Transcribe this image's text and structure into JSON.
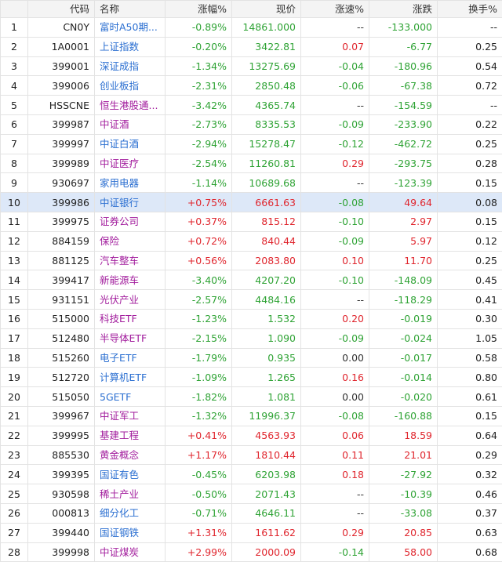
{
  "colors": {
    "up": "#e0262e",
    "down": "#2fa335",
    "name_blue": "#2b6fd1",
    "name_purple": "#a21d9d",
    "selected_row_bg": "#dde8f8"
  },
  "header": {
    "index": "",
    "code": "代码",
    "name": "名称",
    "change_pct": "涨幅%",
    "price": "现价",
    "speed": "涨速%",
    "change": "涨跌",
    "turnover": "换手%"
  },
  "rows": [
    {
      "idx": "1",
      "code": "CN0Y",
      "name": "富时A50期...",
      "name_color": "blue",
      "pct": "-0.89%",
      "price": "14861.000",
      "speed": "--",
      "chg": "-133.000",
      "turn": "--",
      "pct_dir": "down",
      "price_dir": "down",
      "speed_dir": "flat",
      "chg_dir": "down"
    },
    {
      "idx": "2",
      "code": "1A0001",
      "name": "上证指数",
      "name_color": "blue",
      "pct": "-0.20%",
      "price": "3422.81",
      "speed": "0.07",
      "chg": "-6.77",
      "turn": "0.25",
      "pct_dir": "down",
      "price_dir": "down",
      "speed_dir": "up",
      "chg_dir": "down"
    },
    {
      "idx": "3",
      "code": "399001",
      "name": "深证成指",
      "name_color": "blue",
      "pct": "-1.34%",
      "price": "13275.69",
      "speed": "-0.04",
      "chg": "-180.96",
      "turn": "0.54",
      "pct_dir": "down",
      "price_dir": "down",
      "speed_dir": "down",
      "chg_dir": "down"
    },
    {
      "idx": "4",
      "code": "399006",
      "name": "创业板指",
      "name_color": "blue",
      "pct": "-2.31%",
      "price": "2850.48",
      "speed": "-0.06",
      "chg": "-67.38",
      "turn": "0.72",
      "pct_dir": "down",
      "price_dir": "down",
      "speed_dir": "down",
      "chg_dir": "down"
    },
    {
      "idx": "5",
      "code": "HSSCNE",
      "name": "恒生港股通...",
      "name_color": "purple",
      "pct": "-3.42%",
      "price": "4365.74",
      "speed": "--",
      "chg": "-154.59",
      "turn": "--",
      "pct_dir": "down",
      "price_dir": "down",
      "speed_dir": "flat",
      "chg_dir": "down"
    },
    {
      "idx": "6",
      "code": "399987",
      "name": "中证酒",
      "name_color": "purple",
      "pct": "-2.73%",
      "price": "8335.53",
      "speed": "-0.09",
      "chg": "-233.90",
      "turn": "0.22",
      "pct_dir": "down",
      "price_dir": "down",
      "speed_dir": "down",
      "chg_dir": "down"
    },
    {
      "idx": "7",
      "code": "399997",
      "name": "中证白酒",
      "name_color": "blue",
      "pct": "-2.94%",
      "price": "15278.47",
      "speed": "-0.12",
      "chg": "-462.72",
      "turn": "0.25",
      "pct_dir": "down",
      "price_dir": "down",
      "speed_dir": "down",
      "chg_dir": "down"
    },
    {
      "idx": "8",
      "code": "399989",
      "name": "中证医疗",
      "name_color": "purple",
      "pct": "-2.54%",
      "price": "11260.81",
      "speed": "0.29",
      "chg": "-293.75",
      "turn": "0.28",
      "pct_dir": "down",
      "price_dir": "down",
      "speed_dir": "up",
      "chg_dir": "down"
    },
    {
      "idx": "9",
      "code": "930697",
      "name": "家用电器",
      "name_color": "blue",
      "pct": "-1.14%",
      "price": "10689.68",
      "speed": "--",
      "chg": "-123.39",
      "turn": "0.15",
      "pct_dir": "down",
      "price_dir": "down",
      "speed_dir": "flat",
      "chg_dir": "down"
    },
    {
      "idx": "10",
      "code": "399986",
      "name": "中证银行",
      "name_color": "blue",
      "pct": "+0.75%",
      "price": "6661.63",
      "speed": "-0.08",
      "chg": "49.64",
      "turn": "0.08",
      "pct_dir": "up",
      "price_dir": "up",
      "speed_dir": "down",
      "chg_dir": "up",
      "selected": true
    },
    {
      "idx": "11",
      "code": "399975",
      "name": "证券公司",
      "name_color": "purple",
      "pct": "+0.37%",
      "price": "815.12",
      "speed": "-0.10",
      "chg": "2.97",
      "turn": "0.15",
      "pct_dir": "up",
      "price_dir": "up",
      "speed_dir": "down",
      "chg_dir": "up"
    },
    {
      "idx": "12",
      "code": "884159",
      "name": "保险",
      "name_color": "purple",
      "pct": "+0.72%",
      "price": "840.44",
      "speed": "-0.09",
      "chg": "5.97",
      "turn": "0.12",
      "pct_dir": "up",
      "price_dir": "up",
      "speed_dir": "down",
      "chg_dir": "up"
    },
    {
      "idx": "13",
      "code": "881125",
      "name": "汽车整车",
      "name_color": "purple",
      "pct": "+0.56%",
      "price": "2083.80",
      "speed": "0.10",
      "chg": "11.70",
      "turn": "0.25",
      "pct_dir": "up",
      "price_dir": "up",
      "speed_dir": "up",
      "chg_dir": "up"
    },
    {
      "idx": "14",
      "code": "399417",
      "name": "新能源车",
      "name_color": "purple",
      "pct": "-3.40%",
      "price": "4207.20",
      "speed": "-0.10",
      "chg": "-148.09",
      "turn": "0.45",
      "pct_dir": "down",
      "price_dir": "down",
      "speed_dir": "down",
      "chg_dir": "down"
    },
    {
      "idx": "15",
      "code": "931151",
      "name": "光伏产业",
      "name_color": "purple",
      "pct": "-2.57%",
      "price": "4484.16",
      "speed": "--",
      "chg": "-118.29",
      "turn": "0.41",
      "pct_dir": "down",
      "price_dir": "down",
      "speed_dir": "flat",
      "chg_dir": "down"
    },
    {
      "idx": "16",
      "code": "515000",
      "name": "科技ETF",
      "name_color": "purple",
      "pct": "-1.23%",
      "price": "1.532",
      "speed": "0.20",
      "chg": "-0.019",
      "turn": "0.30",
      "pct_dir": "down",
      "price_dir": "down",
      "speed_dir": "up",
      "chg_dir": "down"
    },
    {
      "idx": "17",
      "code": "512480",
      "name": "半导体ETF",
      "name_color": "purple",
      "pct": "-2.15%",
      "price": "1.090",
      "speed": "-0.09",
      "chg": "-0.024",
      "turn": "1.05",
      "pct_dir": "down",
      "price_dir": "down",
      "speed_dir": "down",
      "chg_dir": "down"
    },
    {
      "idx": "18",
      "code": "515260",
      "name": "电子ETF",
      "name_color": "blue",
      "pct": "-1.79%",
      "price": "0.935",
      "speed": "0.00",
      "chg": "-0.017",
      "turn": "0.58",
      "pct_dir": "down",
      "price_dir": "down",
      "speed_dir": "flat",
      "chg_dir": "down"
    },
    {
      "idx": "19",
      "code": "512720",
      "name": "计算机ETF",
      "name_color": "blue",
      "pct": "-1.09%",
      "price": "1.265",
      "speed": "0.16",
      "chg": "-0.014",
      "turn": "0.80",
      "pct_dir": "down",
      "price_dir": "down",
      "speed_dir": "up",
      "chg_dir": "down"
    },
    {
      "idx": "20",
      "code": "515050",
      "name": "5GETF",
      "name_color": "blue",
      "pct": "-1.82%",
      "price": "1.081",
      "speed": "0.00",
      "chg": "-0.020",
      "turn": "0.61",
      "pct_dir": "down",
      "price_dir": "down",
      "speed_dir": "flat",
      "chg_dir": "down"
    },
    {
      "idx": "21",
      "code": "399967",
      "name": "中证军工",
      "name_color": "purple",
      "pct": "-1.32%",
      "price": "11996.37",
      "speed": "-0.08",
      "chg": "-160.88",
      "turn": "0.15",
      "pct_dir": "down",
      "price_dir": "down",
      "speed_dir": "down",
      "chg_dir": "down"
    },
    {
      "idx": "22",
      "code": "399995",
      "name": "基建工程",
      "name_color": "purple",
      "pct": "+0.41%",
      "price": "4563.93",
      "speed": "0.06",
      "chg": "18.59",
      "turn": "0.64",
      "pct_dir": "up",
      "price_dir": "up",
      "speed_dir": "up",
      "chg_dir": "up"
    },
    {
      "idx": "23",
      "code": "885530",
      "name": "黄金概念",
      "name_color": "purple",
      "pct": "+1.17%",
      "price": "1810.44",
      "speed": "0.11",
      "chg": "21.01",
      "turn": "0.29",
      "pct_dir": "up",
      "price_dir": "up",
      "speed_dir": "up",
      "chg_dir": "up"
    },
    {
      "idx": "24",
      "code": "399395",
      "name": "国证有色",
      "name_color": "blue",
      "pct": "-0.45%",
      "price": "6203.98",
      "speed": "0.18",
      "chg": "-27.92",
      "turn": "0.32",
      "pct_dir": "down",
      "price_dir": "down",
      "speed_dir": "up",
      "chg_dir": "down"
    },
    {
      "idx": "25",
      "code": "930598",
      "name": "稀土产业",
      "name_color": "purple",
      "pct": "-0.50%",
      "price": "2071.43",
      "speed": "--",
      "chg": "-10.39",
      "turn": "0.46",
      "pct_dir": "down",
      "price_dir": "down",
      "speed_dir": "flat",
      "chg_dir": "down"
    },
    {
      "idx": "26",
      "code": "000813",
      "name": "细分化工",
      "name_color": "blue",
      "pct": "-0.71%",
      "price": "4646.11",
      "speed": "--",
      "chg": "-33.08",
      "turn": "0.37",
      "pct_dir": "down",
      "price_dir": "down",
      "speed_dir": "flat",
      "chg_dir": "down"
    },
    {
      "idx": "27",
      "code": "399440",
      "name": "国证钢铁",
      "name_color": "blue",
      "pct": "+1.31%",
      "price": "1611.62",
      "speed": "0.29",
      "chg": "20.85",
      "turn": "0.63",
      "pct_dir": "up",
      "price_dir": "up",
      "speed_dir": "up",
      "chg_dir": "up"
    },
    {
      "idx": "28",
      "code": "399998",
      "name": "中证煤炭",
      "name_color": "purple",
      "pct": "+2.99%",
      "price": "2000.09",
      "speed": "-0.14",
      "chg": "58.00",
      "turn": "0.68",
      "pct_dir": "up",
      "price_dir": "up",
      "speed_dir": "down",
      "chg_dir": "up"
    }
  ]
}
